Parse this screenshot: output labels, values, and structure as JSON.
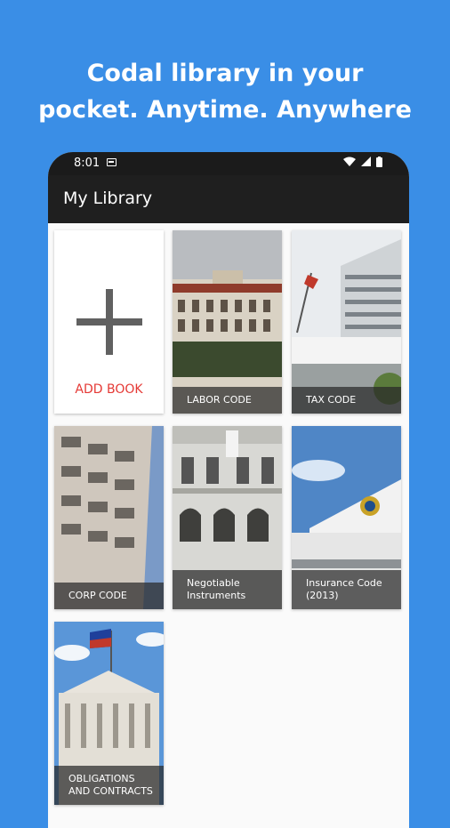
{
  "headline": {
    "line1": "Codal library in your",
    "line2": "pocket. Anytime. Anywhere"
  },
  "status_bar": {
    "time": "8:01"
  },
  "app_bar": {
    "title": "My Library"
  },
  "add_book": {
    "label": "ADD BOOK"
  },
  "books": [
    {
      "title": "LABOR CODE"
    },
    {
      "title": "TAX CODE"
    },
    {
      "title": "CORP CODE"
    },
    {
      "title": "Negotiable Instruments"
    },
    {
      "title": "Insurance Code (2013)"
    },
    {
      "title": "OBLIGATIONS AND CONTRACTS"
    }
  ],
  "colors": {
    "background": "#3a8ee6",
    "add_label": "#e53935",
    "appbar": "#1f1f1f"
  }
}
